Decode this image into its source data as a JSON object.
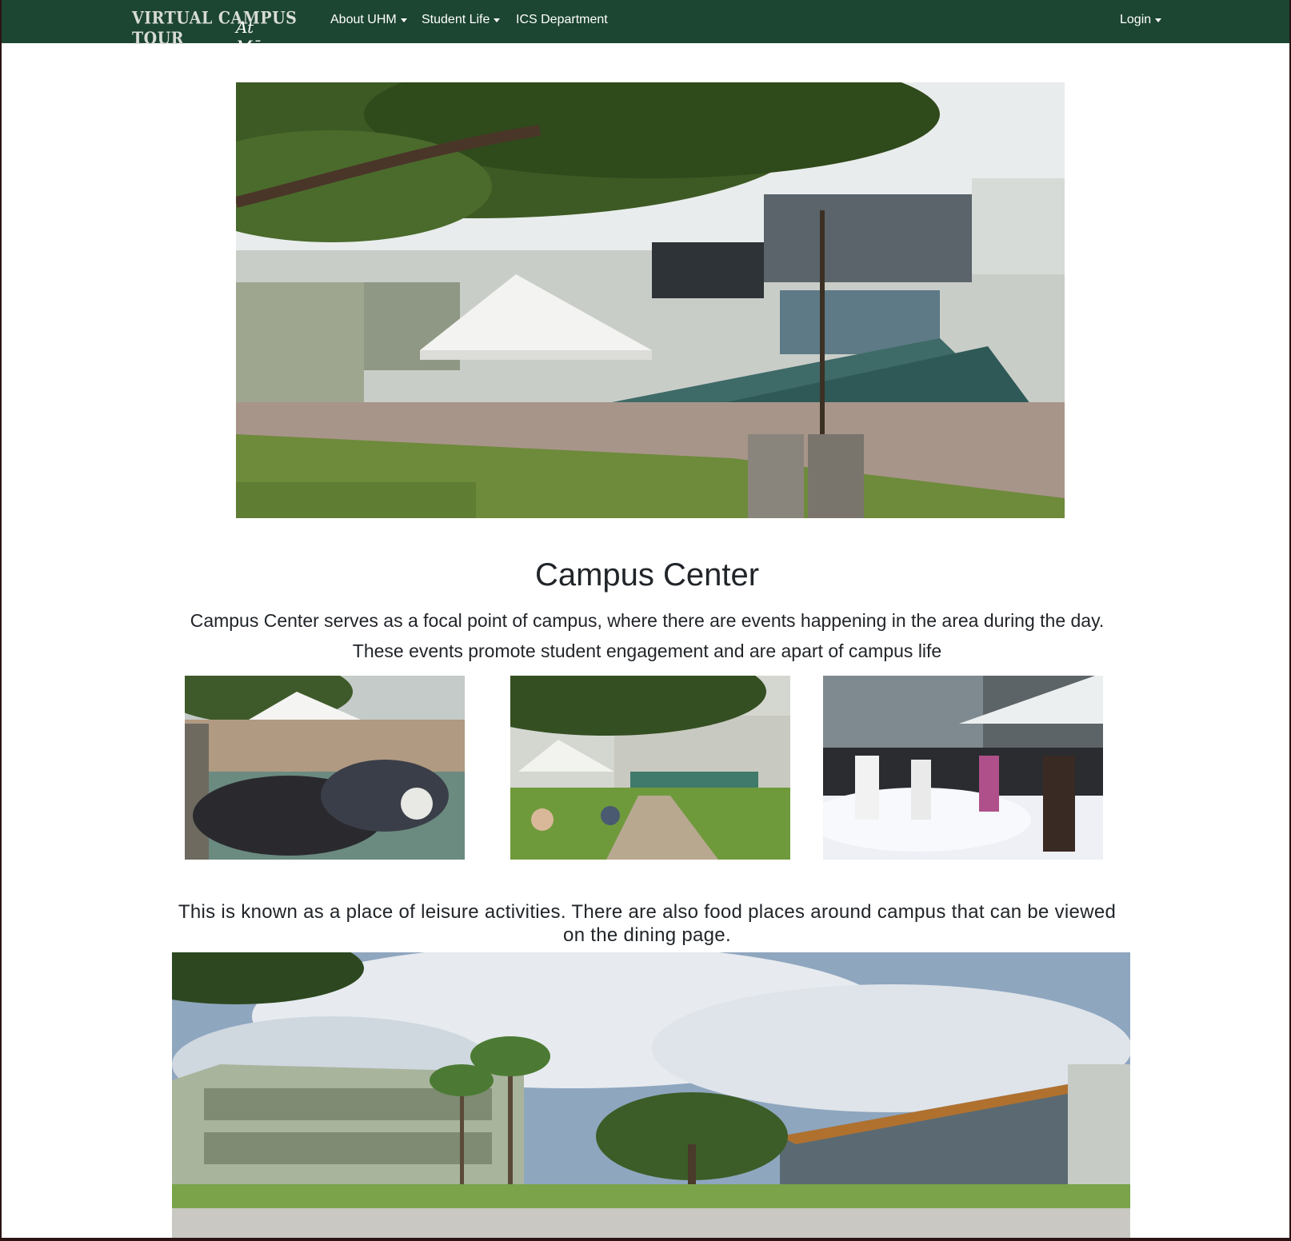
{
  "navbar": {
    "brand_top": "VIRTUAL CAMPUS TOUR",
    "brand_script": "At Mānoa",
    "items": [
      {
        "label": "About UHM",
        "dropdown": true
      },
      {
        "label": "Student Life",
        "dropdown": true
      },
      {
        "label": "ICS Department",
        "dropdown": false
      }
    ],
    "login_label": "Login"
  },
  "main": {
    "title": "Campus Center",
    "description_line1": "Campus Center serves as a focal point of campus, where there are events happening in the area during the day.",
    "description_line2": "These events promote student engagement and are apart of campus life",
    "subtext": "This is known as a place of leisure activities. There are also food places around campus that can be viewed on the dining page."
  },
  "colors": {
    "navbar_bg": "#1c4532",
    "text": "#212529",
    "page_bg": "#ffffff"
  }
}
